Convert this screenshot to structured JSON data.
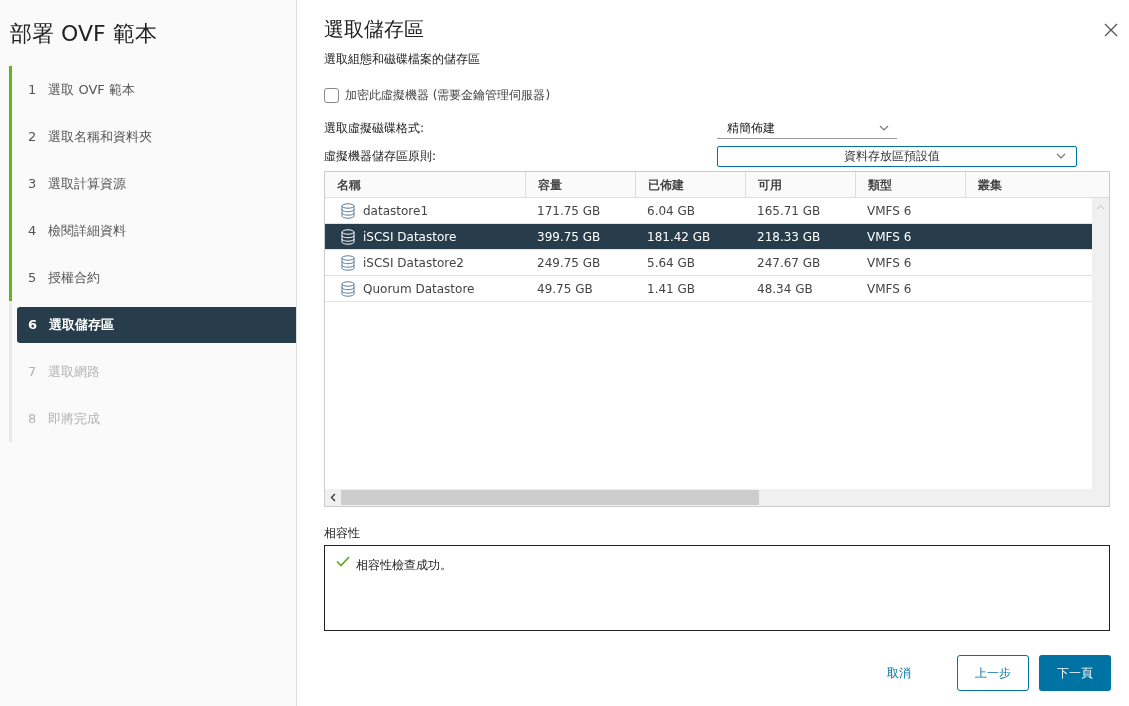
{
  "sidebar": {
    "title": "部署 OVF 範本",
    "steps": [
      {
        "number": "1",
        "label": "選取 OVF 範本",
        "completed": true,
        "selected": false,
        "disabled": false
      },
      {
        "number": "2",
        "label": "選取名稱和資料夾",
        "completed": true,
        "selected": false,
        "disabled": false
      },
      {
        "number": "3",
        "label": "選取計算資源",
        "completed": true,
        "selected": false,
        "disabled": false
      },
      {
        "number": "4",
        "label": "檢閱詳細資料",
        "completed": true,
        "selected": false,
        "disabled": false
      },
      {
        "number": "5",
        "label": "授權合約",
        "completed": true,
        "selected": false,
        "disabled": false
      },
      {
        "number": "6",
        "label": "選取儲存區",
        "completed": false,
        "selected": true,
        "disabled": false
      },
      {
        "number": "7",
        "label": "選取網路",
        "completed": false,
        "selected": false,
        "disabled": true
      },
      {
        "number": "8",
        "label": "即將完成",
        "completed": false,
        "selected": false,
        "disabled": true
      }
    ]
  },
  "page": {
    "title": "選取儲存區",
    "subtitle": "選取組態和磁碟檔案的儲存區",
    "encrypt": {
      "label": "加密此虛擬機器 (需要金鑰管理伺服器)",
      "checked": false
    },
    "disk_format": {
      "label": "選取虛擬磁碟格式:",
      "value": "精簡佈建"
    },
    "storage_policy": {
      "label": "虛擬機器儲存區原則:",
      "value": "資料存放區預設值"
    }
  },
  "table": {
    "columns": [
      "名稱",
      "容量",
      "已佈建",
      "可用",
      "類型",
      "叢集"
    ],
    "rows": [
      {
        "cells": [
          "datastore1",
          "171.75 GB",
          "6.04 GB",
          "165.71 GB",
          "VMFS 6",
          ""
        ],
        "selected": false
      },
      {
        "cells": [
          "iSCSI Datastore",
          "399.75 GB",
          "181.42 GB",
          "218.33 GB",
          "VMFS 6",
          ""
        ],
        "selected": true
      },
      {
        "cells": [
          "iSCSI Datastore2",
          "249.75 GB",
          "5.64 GB",
          "247.67 GB",
          "VMFS 6",
          ""
        ],
        "selected": false
      },
      {
        "cells": [
          "Quorum Datastore",
          "49.75 GB",
          "1.41 GB",
          "48.34 GB",
          "VMFS 6",
          ""
        ],
        "selected": false
      }
    ]
  },
  "compatibility": {
    "label": "相容性",
    "message": "相容性檢查成功。",
    "ok": true
  },
  "buttons": {
    "cancel": "取消",
    "back": "上一步",
    "next": "下一頁"
  }
}
